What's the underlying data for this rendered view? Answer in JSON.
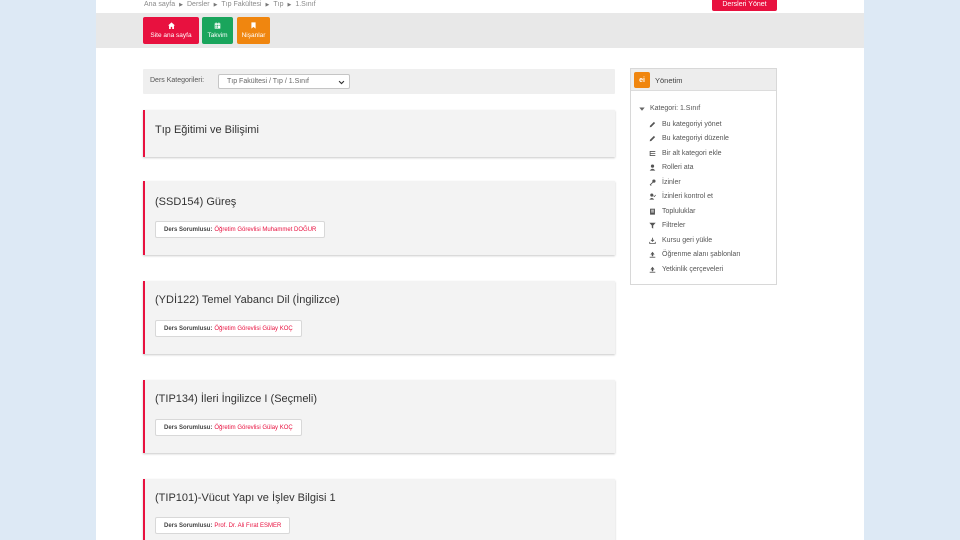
{
  "breadcrumb": [
    "Ana sayfa",
    "Dersler",
    "Tıp Fakültesi",
    "Tıp",
    "1.Sınıf"
  ],
  "header": {
    "manage_courses": "Dersleri Yönet"
  },
  "nav": [
    {
      "label": "Site ana sayfa",
      "icon": "home-icon",
      "color": "#e8113f"
    },
    {
      "label": "Takvim",
      "icon": "calendar-icon",
      "color": "#1aa55c"
    },
    {
      "label": "Nişanlar",
      "icon": "bookmark-icon",
      "color": "#f0860f"
    }
  ],
  "category": {
    "label": "Ders Kategorileri:",
    "selected": "Tıp Fakültesi / Tıp / 1.Sınıf"
  },
  "courses": [
    {
      "title": "Tıp Eğitimi ve Bilişimi"
    },
    {
      "title": "(SSD154) Güreş",
      "teacher_label": "Ders Sorumlusu:",
      "teacher": "Öğretim Görevlisi Muhammet DOĞUR"
    },
    {
      "title": "(YDİ122) Temel Yabancı Dil (İngilizce)",
      "teacher_label": "Ders Sorumlusu:",
      "teacher": "Öğretim Görevlisi Gülay KOÇ"
    },
    {
      "title": "(TIP134) İleri İngilizce I (Seçmeli)",
      "teacher_label": "Ders Sorumlusu:",
      "teacher": "Öğretim Görevlisi Gülay KOÇ"
    },
    {
      "title": "(TIP101)-Vücut Yapı ve İşlev Bilgisi 1",
      "teacher_label": "Ders Sorumlusu:",
      "teacher": "Prof. Dr. Ali Fırat ESMER"
    }
  ],
  "admin": {
    "title": "Yönetim",
    "logo": "ei",
    "root": "Kategori: 1.Sınıf",
    "items": [
      {
        "label": "Bu kategoriyi yönet",
        "icon": "pencil-icon"
      },
      {
        "label": "Bu kategoriyi düzenle",
        "icon": "pencil-icon"
      },
      {
        "label": "Bir alt kategori ekle",
        "icon": "add-category-icon"
      },
      {
        "label": "Rolleri ata",
        "icon": "user-icon"
      },
      {
        "label": "İzinler",
        "icon": "key-icon"
      },
      {
        "label": "İzinleri kontrol et",
        "icon": "check-user-icon"
      },
      {
        "label": "Topluluklar",
        "icon": "users-icon"
      },
      {
        "label": "Filtreler",
        "icon": "filter-icon"
      },
      {
        "label": "Kursu geri yükle",
        "icon": "restore-icon"
      },
      {
        "label": "Öğrenme alanı şablonları",
        "icon": "upload-icon"
      },
      {
        "label": "Yetkinlik çerçeveleri",
        "icon": "upload-icon"
      }
    ]
  }
}
